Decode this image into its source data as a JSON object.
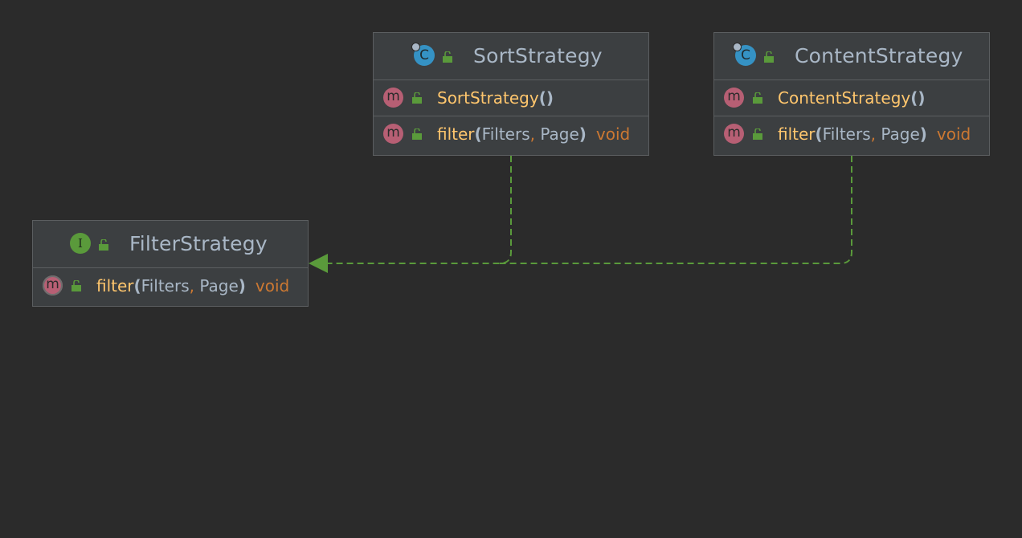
{
  "colors": {
    "background": "#2b2b2b",
    "node_fill": "#3c3f41",
    "node_border": "#5b5e60",
    "class_icon": "#3592c4",
    "interface_icon": "#5a9a3b",
    "method_icon": "#b75f74",
    "edge": "#5a9a3b",
    "title_text": "#a9b7c6",
    "method_name": "#ffc66d",
    "keyword": "#cc7832"
  },
  "nodes": {
    "sort_strategy": {
      "icon": "class-icon",
      "icon_letter": "C",
      "title": "SortStrategy",
      "constructor": {
        "name": "SortStrategy",
        "parens": "()"
      },
      "method": {
        "name": "filter",
        "open": "(",
        "p1": "Filters",
        "comma": ",",
        "p2": " Page",
        "close": ")",
        "ret": "void"
      }
    },
    "content_strategy": {
      "icon": "class-icon",
      "icon_letter": "C",
      "title": "ContentStrategy",
      "constructor": {
        "name": "ContentStrategy",
        "parens": "()"
      },
      "method": {
        "name": "filter",
        "open": "(",
        "p1": "Filters",
        "comma": ",",
        "p2": " Page",
        "close": ")",
        "ret": "void"
      }
    },
    "filter_strategy": {
      "icon": "interface-icon",
      "icon_letter": "I",
      "title": "FilterStrategy",
      "method": {
        "name": "filter",
        "open": "(",
        "p1": "Filters",
        "comma": ",",
        "p2": " Page",
        "close": ")",
        "ret": "void"
      }
    }
  },
  "method_icon_letter": "m",
  "edges": [
    {
      "from": "SortStrategy",
      "to": "FilterStrategy",
      "relation": "realization"
    },
    {
      "from": "ContentStrategy",
      "to": "FilterStrategy",
      "relation": "realization"
    }
  ]
}
